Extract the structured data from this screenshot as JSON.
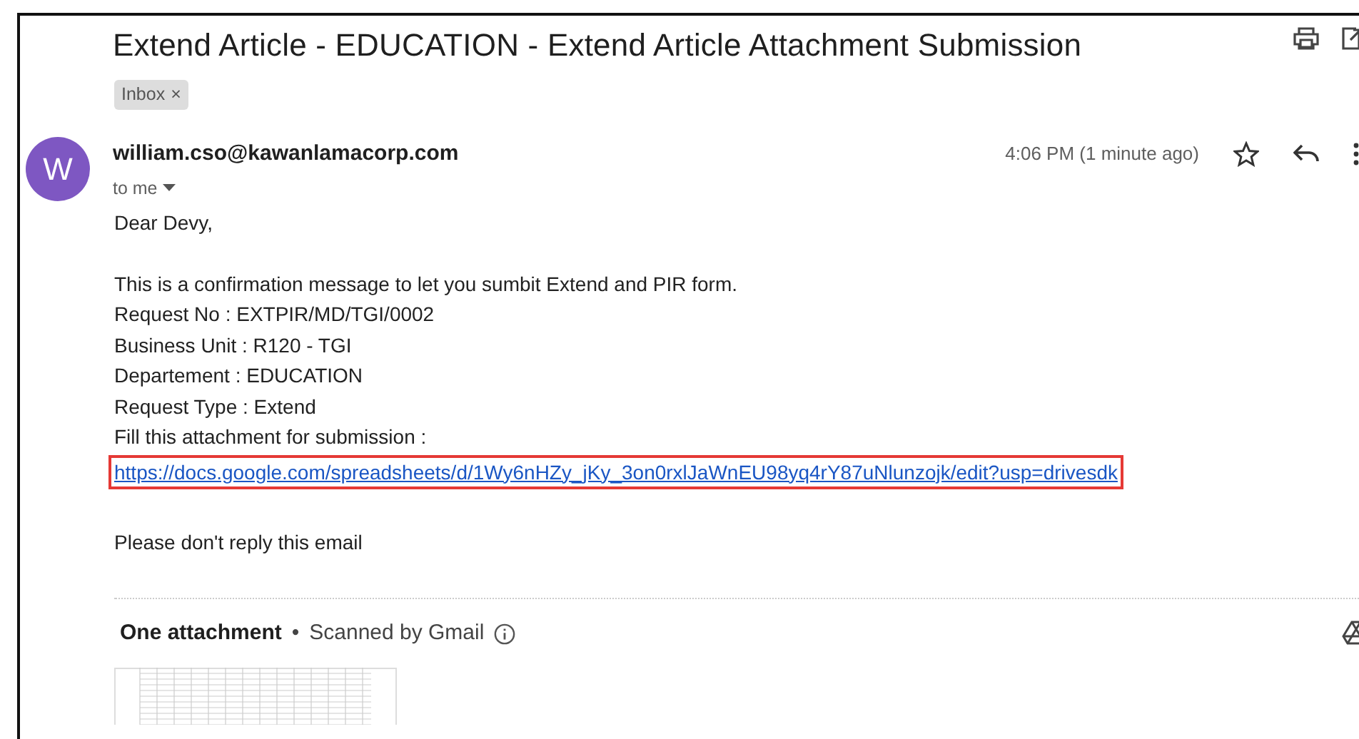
{
  "email": {
    "subject": "Extend Article - EDUCATION - Extend Article Attachment Submission",
    "labels": [
      {
        "text": "Inbox",
        "close": "×"
      }
    ],
    "avatar": "W",
    "sender": "william.cso@kawanlamacorp.com",
    "recipient": "to me",
    "time": "4:06 PM (1 minute ago)",
    "starred": false,
    "body": [
      {
        "kind": "text",
        "text": "Dear Devy,"
      },
      {
        "kind": "gap"
      },
      {
        "kind": "text",
        "text": "This is a confirmation message to let you sumbit Extend and PIR form."
      },
      {
        "kind": "text",
        "text": "Request No : EXTPIR/MD/TGI/0002"
      },
      {
        "kind": "text",
        "text": "Business Unit : R120 - TGI"
      },
      {
        "kind": "text",
        "text": "Departement : EDUCATION"
      },
      {
        "kind": "text",
        "text": "Request Type : Extend"
      },
      {
        "kind": "text",
        "text": "Fill this attachment for submission :"
      },
      {
        "kind": "link",
        "text": "https://docs.google.com/spreadsheets/d/1Wy6nHZy_jKy_3on0rxlJaWnEU98yq4rY87uNlunzojk/edit?usp=drivesdk",
        "highlighted": true
      },
      {
        "kind": "gap"
      },
      {
        "kind": "text",
        "text": "Please don't reply this email"
      }
    ],
    "attachments": {
      "title": "One attachment",
      "separator": "•",
      "scan_note": "Scanned by Gmail"
    }
  }
}
